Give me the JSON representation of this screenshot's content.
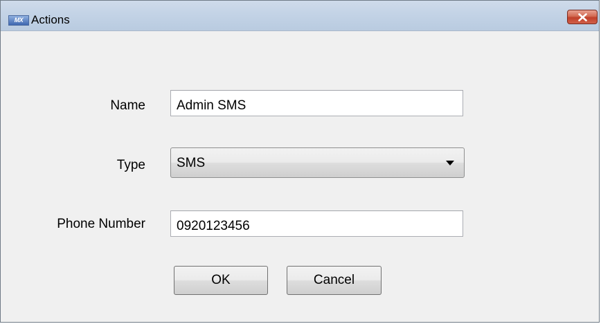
{
  "window": {
    "title": "Actions",
    "app_icon_text": "MX",
    "close_icon": "close-icon"
  },
  "form": {
    "name": {
      "label": "Name",
      "value": "Admin SMS"
    },
    "type": {
      "label": "Type",
      "selected": "SMS"
    },
    "phone": {
      "label": "Phone Number",
      "value": "0920123456"
    }
  },
  "buttons": {
    "ok_label": "OK",
    "cancel_label": "Cancel"
  },
  "colors": {
    "titlebar": "#c3d3e6",
    "close_button": "#c0402a",
    "window_background": "#f0f0f0"
  }
}
